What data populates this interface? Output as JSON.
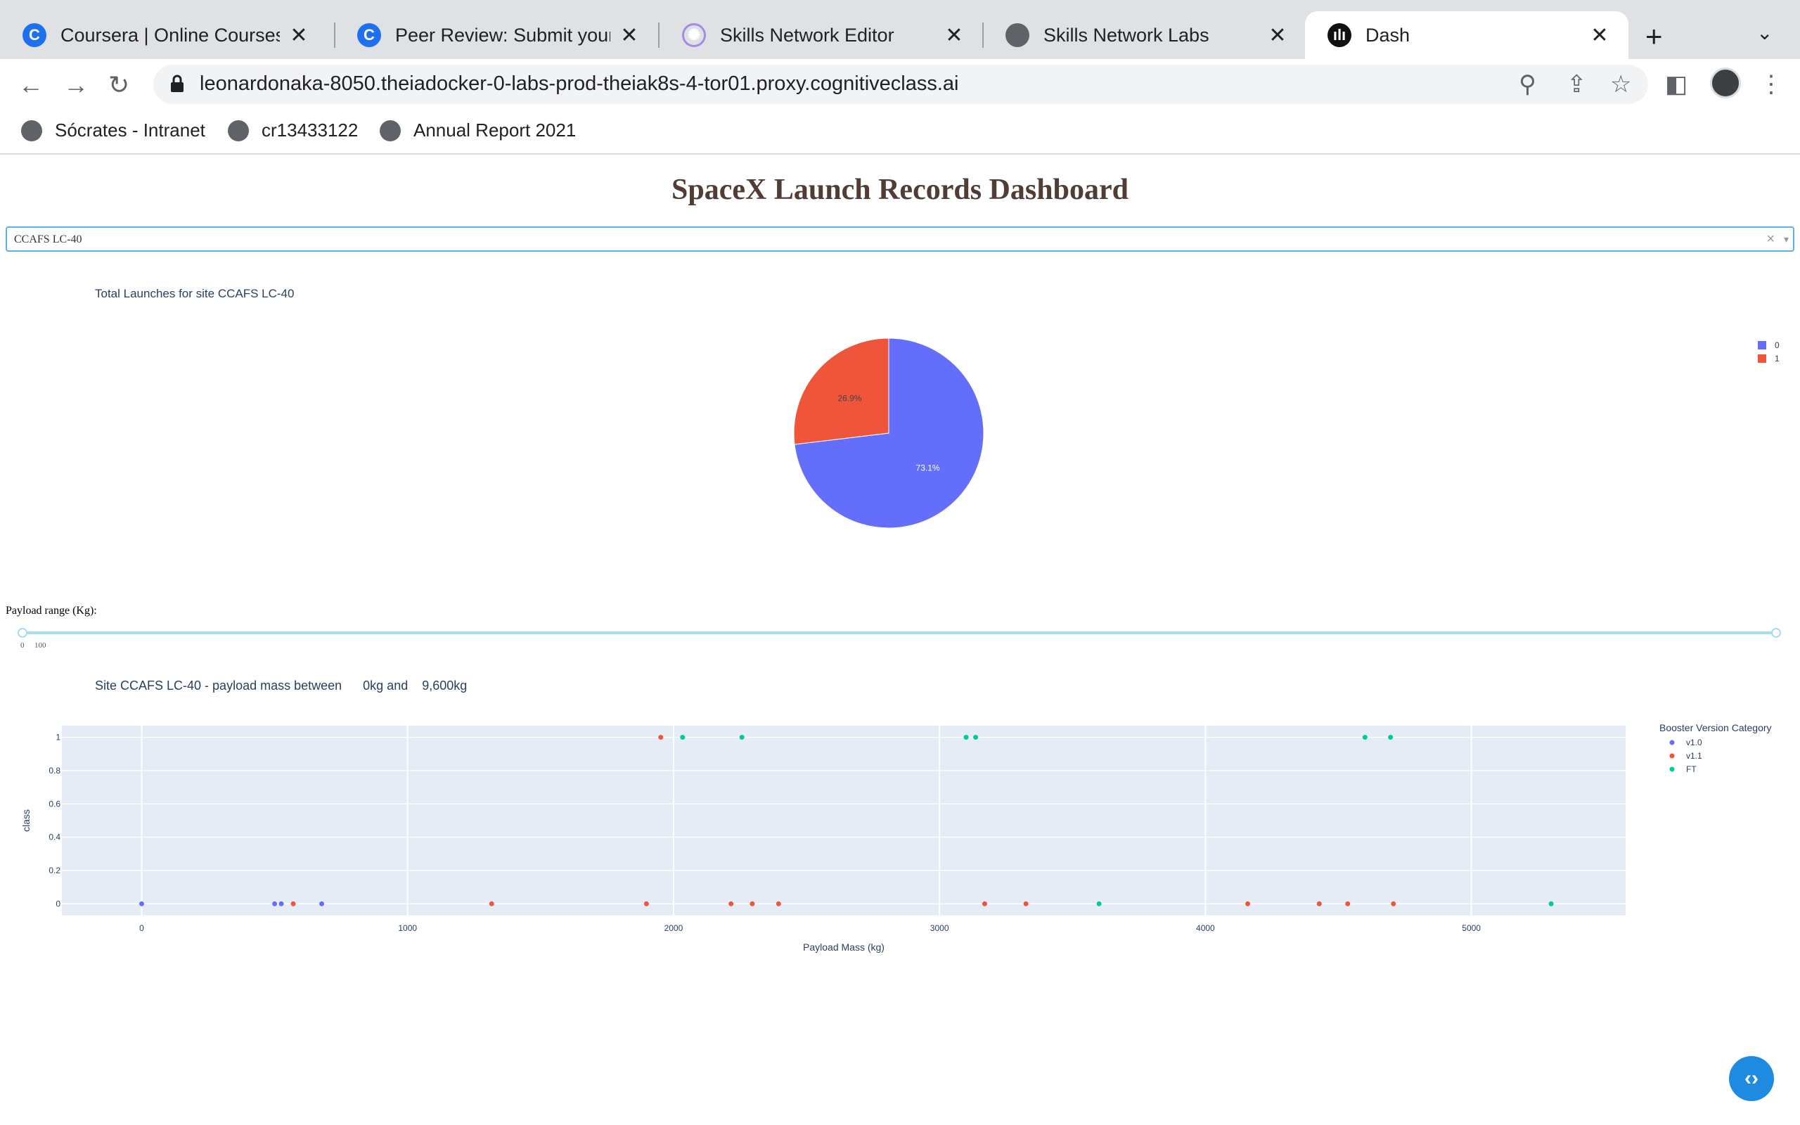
{
  "browser": {
    "tabs": [
      {
        "title": "Coursera | Online Courses & Credentials",
        "icon": "coursera-icon"
      },
      {
        "title": "Peer Review: Submit your Work",
        "icon": "coursera-icon"
      },
      {
        "title": "Skills Network Editor",
        "icon": "skills-network-editor-icon"
      },
      {
        "title": "Skills Network Labs",
        "icon": "globe-icon"
      },
      {
        "title": "Dash",
        "icon": "dash-icon"
      }
    ],
    "url": "leonardonaka-8050.theiadocker-0-labs-prod-theiak8s-4-tor01.proxy.cognitiveclass.ai",
    "bookmarks": [
      "Sócrates - Intranet",
      "cr13433122",
      "Annual Report 2021"
    ]
  },
  "dashboard": {
    "title": "SpaceX Launch Records Dashboard",
    "site_dropdown_value": "CCAFS LC-40",
    "pie_title": "Total Launches for site CCAFS LC-40",
    "payload_label": "Payload range (Kg):",
    "slider_marks": [
      "0",
      "100"
    ],
    "scatter_title": "Site CCAFS LC-40 - payload mass between      0kg and    9,600kg"
  },
  "chart_data": [
    {
      "type": "pie",
      "title": "Total Launches for site CCAFS LC-40",
      "labels": [
        "0",
        "1"
      ],
      "values": [
        73.1,
        26.9
      ],
      "text": [
        "73.1%",
        "26.9%"
      ],
      "colors": [
        "#636efa",
        "#ef553b"
      ],
      "legend": "top-right"
    },
    {
      "type": "scatter",
      "xlabel": "Payload Mass (kg)",
      "ylabel": "class",
      "xlim": [
        -300,
        5580
      ],
      "ylim": [
        -0.07,
        1.07
      ],
      "xticks": [
        0,
        1000,
        2000,
        3000,
        4000,
        5000
      ],
      "yticks": [
        0,
        0.2,
        0.4,
        0.6,
        0.8,
        1
      ],
      "ytick_labels": [
        "0",
        "0.2",
        "0.4",
        "0.6",
        "0.8",
        "1"
      ],
      "legend_title": "Booster Version Category",
      "legend": "top-right",
      "grid": true,
      "series": [
        {
          "name": "v1.0",
          "color": "#636efa",
          "points": [
            [
              0,
              0
            ],
            [
              500,
              0
            ],
            [
              525,
              0
            ],
            [
              677,
              0
            ]
          ]
        },
        {
          "name": "v1.1",
          "color": "#ef553b",
          "points": [
            [
              570,
              0
            ],
            [
              1316,
              0
            ],
            [
              1898,
              0
            ],
            [
              2216,
              0
            ],
            [
              2296,
              0
            ],
            [
              2395,
              0
            ],
            [
              3170,
              0
            ],
            [
              3325,
              0
            ],
            [
              4159,
              0
            ],
            [
              4428,
              0
            ],
            [
              4535,
              0
            ],
            [
              4707,
              0
            ],
            [
              1952,
              1
            ]
          ]
        },
        {
          "name": "FT",
          "color": "#00cc96",
          "points": [
            [
              2034,
              1
            ],
            [
              2257,
              1
            ],
            [
              3100,
              1
            ],
            [
              3136,
              1
            ],
            [
              3600,
              0
            ],
            [
              4600,
              1
            ],
            [
              4696,
              1
            ],
            [
              5300,
              0
            ]
          ]
        }
      ]
    }
  ]
}
